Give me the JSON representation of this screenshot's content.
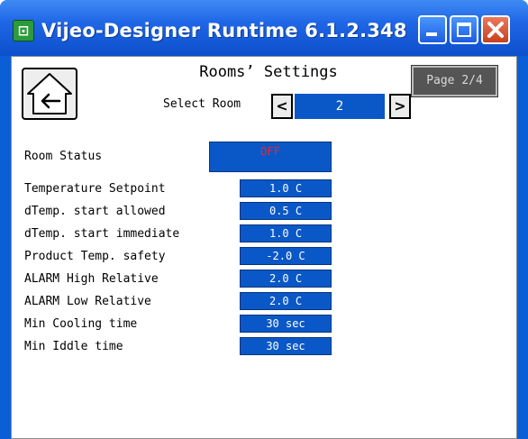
{
  "window": {
    "title": "Vijeo-Designer Runtime 6.1.2.348",
    "app_icon_glyph": "⊡",
    "controls": [
      "minimize-icon",
      "maximize-icon",
      "close-icon"
    ]
  },
  "header": {
    "page_title": "Rooms’ Settings",
    "page_indicator": "Page 2/4",
    "home_icon": "back-arrow-icon"
  },
  "room_selector": {
    "label": "Select Room",
    "prev_glyph": "<",
    "next_glyph": ">",
    "value": "2"
  },
  "status": {
    "label": "Room Status",
    "value": "OFF",
    "value_color": "#ff1e1e"
  },
  "settings": [
    {
      "label": "Temperature Setpoint",
      "value": "1.0 C"
    },
    {
      "label": "dTemp. start allowed",
      "value": "0.5 C"
    },
    {
      "label": "dTemp. start immediate",
      "value": "1.0 C"
    },
    {
      "label": "Product Temp. safety",
      "value": "-2.0 C"
    },
    {
      "label": "ALARM High Relative",
      "value": "2.0 C"
    },
    {
      "label": "ALARM Low Relative",
      "value": "2.0 C"
    },
    {
      "label": "Min Cooling time",
      "value": "30 sec"
    },
    {
      "label": "Min Iddle time",
      "value": "30 sec"
    }
  ],
  "colors": {
    "titlebar": "#1f66e6",
    "field_bg": "#0a58c8",
    "field_text": "#ffffff"
  }
}
